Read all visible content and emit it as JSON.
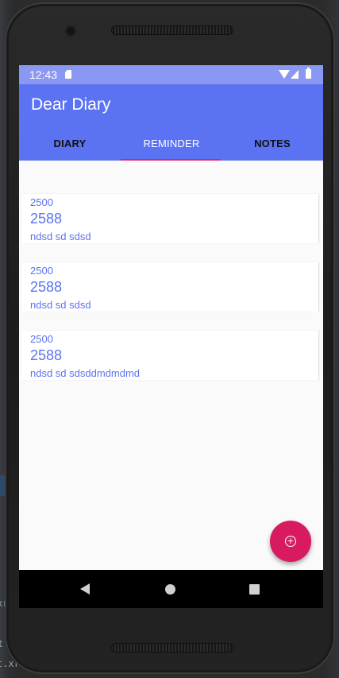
{
  "statusbar": {
    "time": "12:43",
    "icons": [
      "sd-card-icon",
      "wifi-icon",
      "signal-icon",
      "battery-icon"
    ]
  },
  "appbar": {
    "title": "Dear Diary",
    "color": "#5b73f2"
  },
  "tabs": [
    {
      "label": "DIARY",
      "active": false
    },
    {
      "label": "REMINDER",
      "active": true
    },
    {
      "label": "NOTES",
      "active": false
    }
  ],
  "reminders": [
    {
      "amount": "2500",
      "title": "2588",
      "description": "ndsd sd sdsd"
    },
    {
      "amount": "2500",
      "title": "2588",
      "description": "ndsd sd sdsd"
    },
    {
      "amount": "2500",
      "title": "2588",
      "description": "ndsd sd sdsddmdmdmd"
    }
  ],
  "fab": {
    "icon": "add-circle-icon",
    "color": "#d81b60"
  },
  "navbar": {
    "icons": [
      "back-icon",
      "home-icon",
      "recents-icon"
    ]
  },
  "ide_fragments": {
    "left_a": "t",
    "left_b": "t.xr",
    "left_c": "xr"
  }
}
